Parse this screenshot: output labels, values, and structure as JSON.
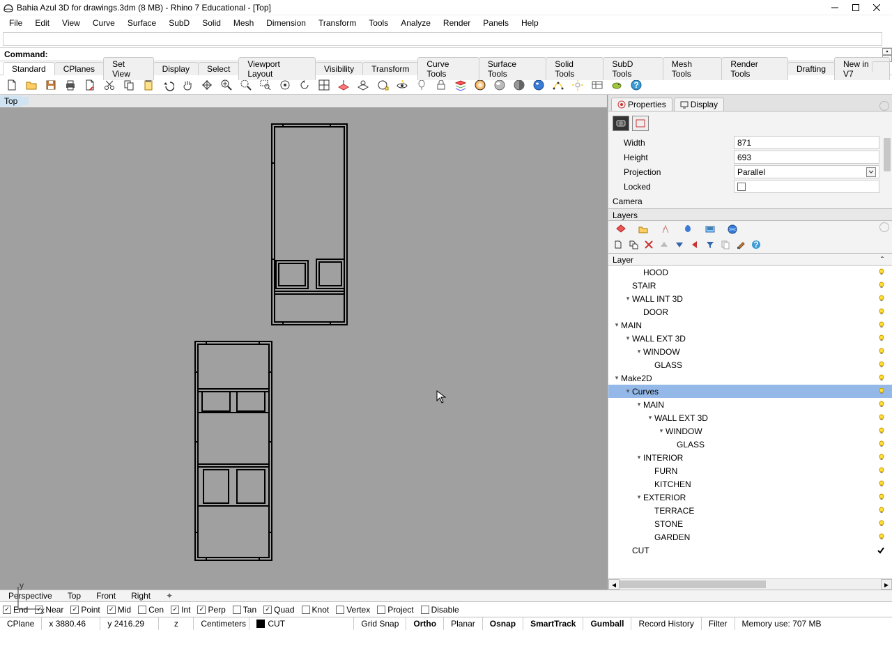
{
  "title": "Bahia Azul 3D for drawings.3dm (8 MB) - Rhino 7 Educational - [Top]",
  "menu": [
    "File",
    "Edit",
    "View",
    "Curve",
    "Surface",
    "SubD",
    "Solid",
    "Mesh",
    "Dimension",
    "Transform",
    "Tools",
    "Analyze",
    "Render",
    "Panels",
    "Help"
  ],
  "command_label": "Command:",
  "tabstrip": [
    "Standard",
    "CPlanes",
    "Set View",
    "Display",
    "Select",
    "Viewport Layout",
    "Visibility",
    "Transform",
    "Curve Tools",
    "Surface Tools",
    "Solid Tools",
    "SubD Tools",
    "Mesh Tools",
    "Render Tools",
    "Drafting",
    "New in V7"
  ],
  "viewport_label": "Top",
  "panel_tabs": {
    "properties": "Properties",
    "display": "Display"
  },
  "properties": {
    "width_label": "Width",
    "width": "871",
    "height_label": "Height",
    "height": "693",
    "projection_label": "Projection",
    "projection": "Parallel",
    "locked_label": "Locked",
    "camera_label": "Camera"
  },
  "layers_title": "Layers",
  "layers_colhdr": "Layer",
  "layers": [
    {
      "indent": 2,
      "name": "HOOD",
      "twisty": "",
      "sel": false,
      "bulb": true
    },
    {
      "indent": 1,
      "name": "STAIR",
      "twisty": "",
      "sel": false,
      "bulb": true
    },
    {
      "indent": 1,
      "name": "WALL INT 3D",
      "twisty": "v",
      "sel": false,
      "bulb": true
    },
    {
      "indent": 2,
      "name": "DOOR",
      "twisty": "",
      "sel": false,
      "bulb": true
    },
    {
      "indent": 0,
      "name": "MAIN",
      "twisty": "v",
      "sel": false,
      "bulb": true
    },
    {
      "indent": 1,
      "name": "WALL EXT 3D",
      "twisty": "v",
      "sel": false,
      "bulb": true
    },
    {
      "indent": 2,
      "name": "WINDOW",
      "twisty": "v",
      "sel": false,
      "bulb": true
    },
    {
      "indent": 3,
      "name": "GLASS",
      "twisty": "",
      "sel": false,
      "bulb": true
    },
    {
      "indent": 0,
      "name": "Make2D",
      "twisty": "v",
      "sel": false,
      "bulb": true
    },
    {
      "indent": 1,
      "name": "Curves",
      "twisty": "v",
      "sel": true,
      "bulb": true
    },
    {
      "indent": 2,
      "name": "MAIN",
      "twisty": "v",
      "sel": false,
      "bulb": true
    },
    {
      "indent": 3,
      "name": "WALL EXT 3D",
      "twisty": "v",
      "sel": false,
      "bulb": true
    },
    {
      "indent": 4,
      "name": "WINDOW",
      "twisty": "v",
      "sel": false,
      "bulb": true
    },
    {
      "indent": 5,
      "name": "GLASS",
      "twisty": "",
      "sel": false,
      "bulb": true
    },
    {
      "indent": 2,
      "name": "INTERIOR",
      "twisty": "v",
      "sel": false,
      "bulb": true
    },
    {
      "indent": 3,
      "name": "FURN",
      "twisty": "",
      "sel": false,
      "bulb": true
    },
    {
      "indent": 3,
      "name": "KITCHEN",
      "twisty": "",
      "sel": false,
      "bulb": true
    },
    {
      "indent": 2,
      "name": "EXTERIOR",
      "twisty": "v",
      "sel": false,
      "bulb": true
    },
    {
      "indent": 3,
      "name": "TERRACE",
      "twisty": "",
      "sel": false,
      "bulb": true
    },
    {
      "indent": 3,
      "name": "STONE",
      "twisty": "",
      "sel": false,
      "bulb": true
    },
    {
      "indent": 3,
      "name": "GARDEN",
      "twisty": "",
      "sel": false,
      "bulb": true
    },
    {
      "indent": 1,
      "name": "CUT",
      "twisty": "",
      "sel": false,
      "bulb": false,
      "check": true
    }
  ],
  "viewtabs": [
    "Perspective",
    "Top",
    "Front",
    "Right"
  ],
  "osnaps": [
    {
      "label": "End",
      "on": true
    },
    {
      "label": "Near",
      "on": true
    },
    {
      "label": "Point",
      "on": true
    },
    {
      "label": "Mid",
      "on": true
    },
    {
      "label": "Cen",
      "on": false
    },
    {
      "label": "Int",
      "on": true
    },
    {
      "label": "Perp",
      "on": true
    },
    {
      "label": "Tan",
      "on": false
    },
    {
      "label": "Quad",
      "on": true
    },
    {
      "label": "Knot",
      "on": false
    },
    {
      "label": "Vertex",
      "on": false
    },
    {
      "label": "Project",
      "on": false
    },
    {
      "label": "Disable",
      "on": false
    }
  ],
  "status": {
    "cplane": "CPlane",
    "x": "x 3880.46",
    "y": "y 2416.29",
    "z": "z",
    "units": "Centimeters",
    "layer": "CUT",
    "gridsnap": "Grid Snap",
    "ortho": "Ortho",
    "planar": "Planar",
    "osnap": "Osnap",
    "smarttrack": "SmartTrack",
    "gumball": "Gumball",
    "record": "Record History",
    "filter": "Filter",
    "memory": "Memory use: 707 MB"
  }
}
